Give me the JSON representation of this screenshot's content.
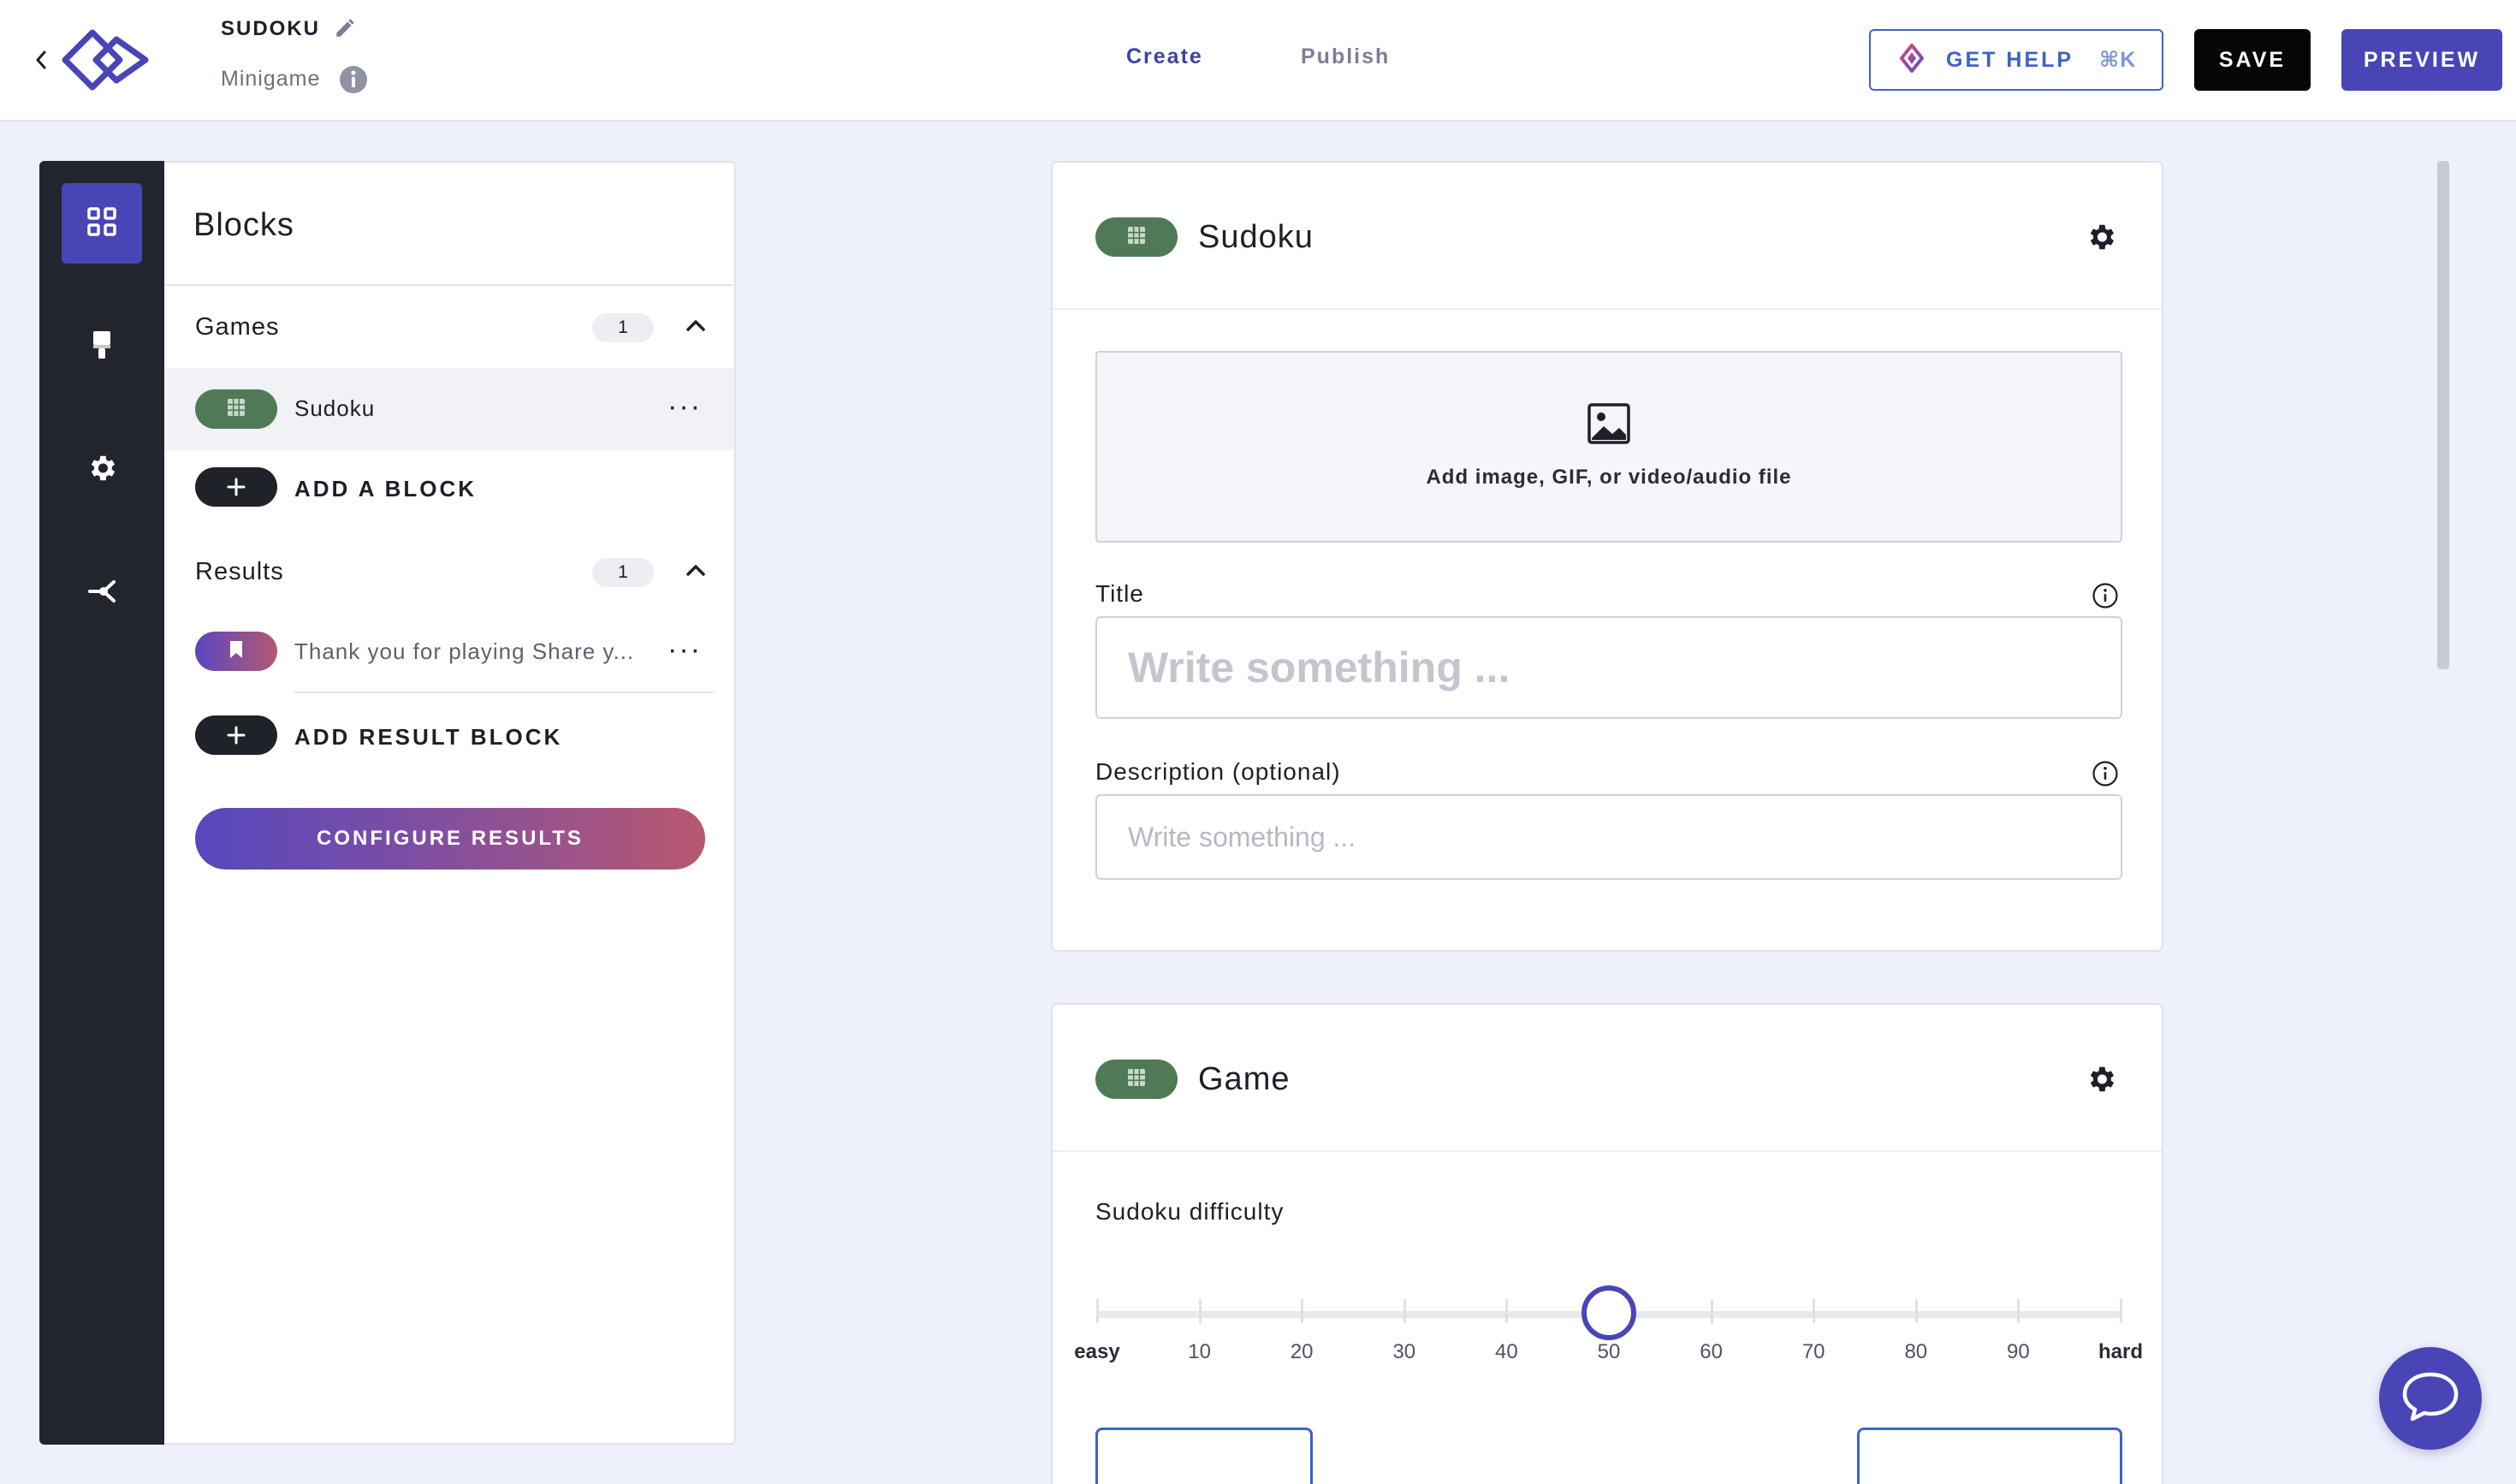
{
  "header": {
    "title": "SUDOKU",
    "subtitle": "Minigame",
    "tabs": [
      {
        "label": "Create",
        "active": true
      },
      {
        "label": "Publish",
        "active": false
      }
    ],
    "help_label": "GET HELP",
    "help_shortcut": "⌘K",
    "save_label": "SAVE",
    "preview_label": "PREVIEW"
  },
  "rail": {
    "items": [
      {
        "icon": "grid-icon",
        "active": true
      },
      {
        "icon": "paintbrush-icon",
        "active": false
      },
      {
        "icon": "gear-icon",
        "active": false
      },
      {
        "icon": "share-icon",
        "active": false
      }
    ]
  },
  "blocks_panel": {
    "title": "Blocks",
    "games": {
      "label": "Games",
      "count": "1",
      "items": [
        {
          "label": "Sudoku",
          "icon": "sudoku-grid-icon"
        }
      ],
      "add_label": "ADD A BLOCK"
    },
    "results": {
      "label": "Results",
      "count": "1",
      "items": [
        {
          "label": "Thank you for playing Share y...",
          "icon": "bookmark-icon"
        }
      ],
      "add_label": "ADD RESULT BLOCK"
    },
    "configure_label": "CONFIGURE RESULTS"
  },
  "sudoku_card": {
    "title": "Sudoku",
    "upload_text": "Add image, GIF, or video/audio file",
    "title_field": {
      "label": "Title",
      "placeholder": "Write something ...",
      "value": ""
    },
    "description_field": {
      "label": "Description (optional)",
      "placeholder": "Write something ...",
      "value": ""
    }
  },
  "game_card": {
    "title": "Game",
    "slider": {
      "label": "Sudoku difficulty",
      "min_label": "easy",
      "max_label": "hard",
      "ticks": [
        "10",
        "20",
        "30",
        "40",
        "50",
        "60",
        "70",
        "80",
        "90"
      ],
      "value": 50,
      "min": 0,
      "max": 100
    }
  },
  "colors": {
    "accent": "#4a45b7",
    "help_blue": "#3e62c9",
    "block_green": "#4f7a55",
    "rail_dark": "#22252d",
    "gradient_start": "#5648bd",
    "gradient_end": "#b85870",
    "canvas_bg": "#eef0fb"
  }
}
